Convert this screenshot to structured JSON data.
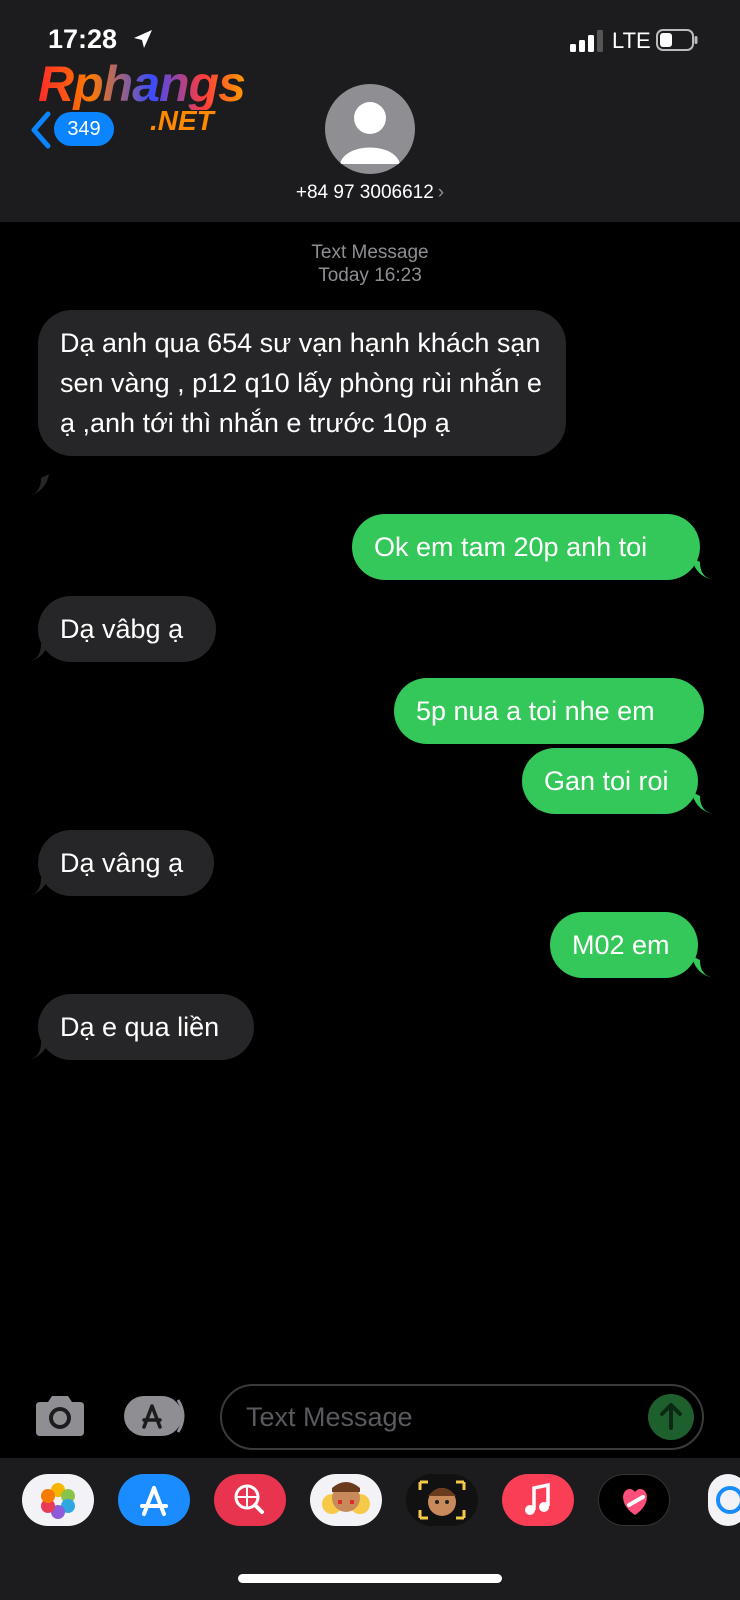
{
  "status": {
    "time": "17:28",
    "network": "LTE"
  },
  "watermark": {
    "top": "Rphangs",
    "bottom": ".NET"
  },
  "nav": {
    "back_count": "349",
    "contact": "+84 97 3006612",
    "contact_chevron": "›"
  },
  "meta": {
    "service": "Text Message",
    "timestamp": "Today 16:23"
  },
  "messages": [
    {
      "dir": "in",
      "text": "Dạ anh qua 654 sư vạn hạnh khách sạn sen vàng , p12 q10 lấy phòng rùi nhắn e ạ ,anh tới thì nhắn e trước 10p ạ"
    },
    {
      "dir": "out",
      "text": "Ok em tam 20p anh toi"
    },
    {
      "dir": "in",
      "text": "Dạ vâbg ạ"
    },
    {
      "dir": "out",
      "text": "5p nua a toi nhe em"
    },
    {
      "dir": "out",
      "text": "Gan toi roi"
    },
    {
      "dir": "in",
      "text": "Dạ vâng ạ"
    },
    {
      "dir": "out",
      "text": "M02 em"
    },
    {
      "dir": "in",
      "text": "Dạ e qua liền"
    }
  ],
  "composer": {
    "placeholder": "Text Message"
  },
  "tray": {
    "apps": [
      "photos-icon",
      "app-store-icon",
      "web-search-icon",
      "memoji-stickers-icon",
      "animoji-icon",
      "music-icon",
      "digital-touch-icon",
      "more-apps-icon"
    ]
  },
  "colors": {
    "incoming_bubble": "#262628",
    "outgoing_bubble": "#34c759",
    "accent": "#0a84ff"
  }
}
